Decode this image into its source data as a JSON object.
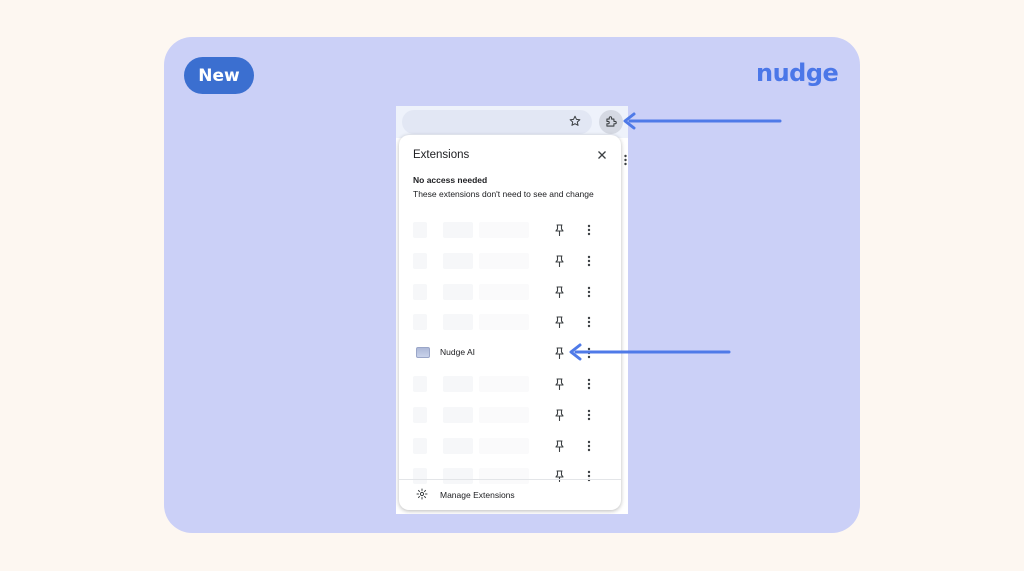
{
  "brand": {
    "badge_label": "New",
    "logo_text": "nudge"
  },
  "colors": {
    "background": "#fdf7f1",
    "card": "#cbd0f7",
    "badge": "#3b6fd0",
    "logo": "#4b77e8",
    "arrow": "#4f7ae8"
  },
  "toolbar": {
    "bookmark_icon": "star-icon",
    "extensions_icon": "puzzle-icon"
  },
  "panel": {
    "title": "Extensions",
    "close_icon": "close-icon",
    "section_title": "No access needed",
    "section_description": "These extensions don't need to see and change",
    "rows": [
      {
        "name": ""
      },
      {
        "name": ""
      },
      {
        "name": ""
      },
      {
        "name": ""
      },
      {
        "name": "Nudge AI"
      },
      {
        "name": ""
      },
      {
        "name": ""
      },
      {
        "name": ""
      },
      {
        "name": ""
      }
    ],
    "footer_label": "Manage Extensions",
    "footer_icon": "gear-icon"
  },
  "annotations": {
    "arrow_targets": [
      "extensions-button",
      "nudge-ai-pin"
    ]
  }
}
